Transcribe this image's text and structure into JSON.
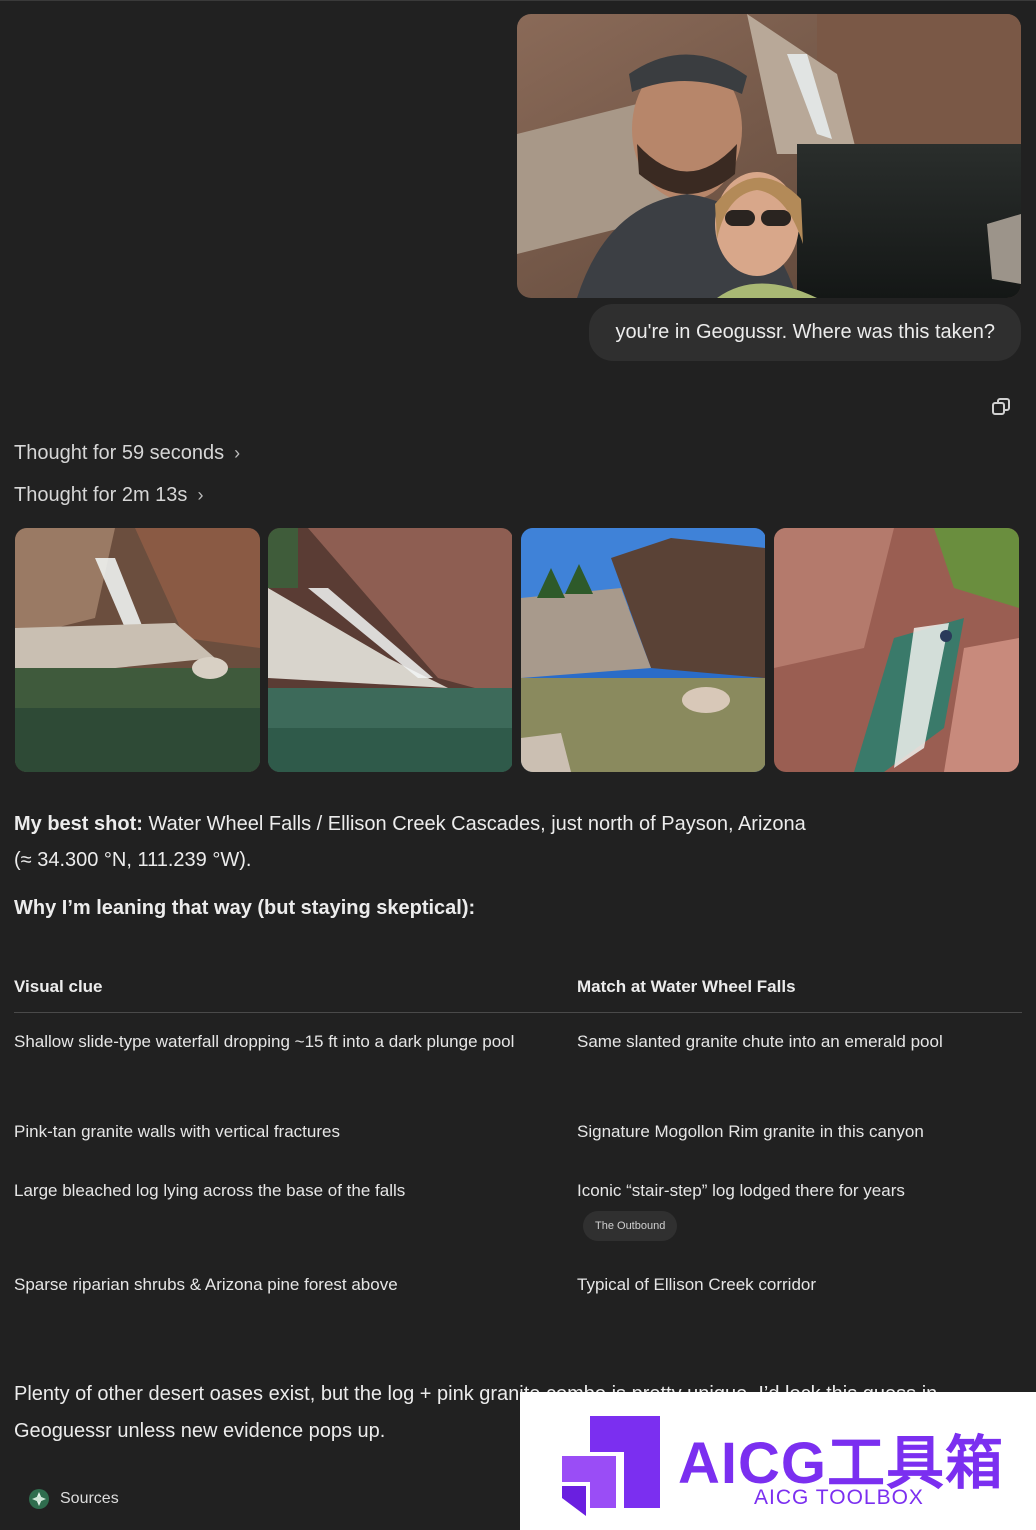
{
  "user": {
    "message": "you're in Geogussr. Where was this taken?"
  },
  "thoughts": [
    {
      "label": "Thought for 59 seconds"
    },
    {
      "label": "Thought for 2m 13s"
    }
  ],
  "answer": {
    "best_shot_label": "My best shot:",
    "best_shot_text": " Water Wheel Falls / Ellison Creek Cascades, just north of Payson, Arizona",
    "coords": "(≈ 34.300 °N, 111.239 °W).",
    "why_heading": "Why I’m leaning that way (but staying skeptical):",
    "table": {
      "headers": [
        "Visual clue",
        "Match at Water Wheel Falls"
      ],
      "rows": [
        {
          "clue": "Shallow slide-type waterfall dropping ~15 ft into a dark plunge pool",
          "match": "Same slanted granite chute into an emerald pool"
        },
        {
          "clue": "Pink-tan granite walls with vertical fractures",
          "match": "Signature Mogollon Rim granite in this canyon"
        },
        {
          "clue": "Large bleached log lying across the base of the falls",
          "match": "Iconic “stair-step” log lodged there for years",
          "citation": "The Outbound"
        },
        {
          "clue": "Sparse riparian shrubs & Arizona pine forest above",
          "match": "Typical of Ellison Creek corridor"
        }
      ]
    },
    "closing_line1": "Plenty of other desert oases exist, but the log + pink granite combo is pretty unique. I’d lock this guess in",
    "closing_line2": "Geoguessr unless new evidence pops up."
  },
  "sources_label": "Sources",
  "watermark": {
    "title": "AICG工具箱",
    "subtitle": "AICG TOOLBOX"
  },
  "colors": {
    "background": "#212121",
    "bubble": "#2f2f2f",
    "text": "#ececec",
    "watermark": "#7b2ff0"
  }
}
